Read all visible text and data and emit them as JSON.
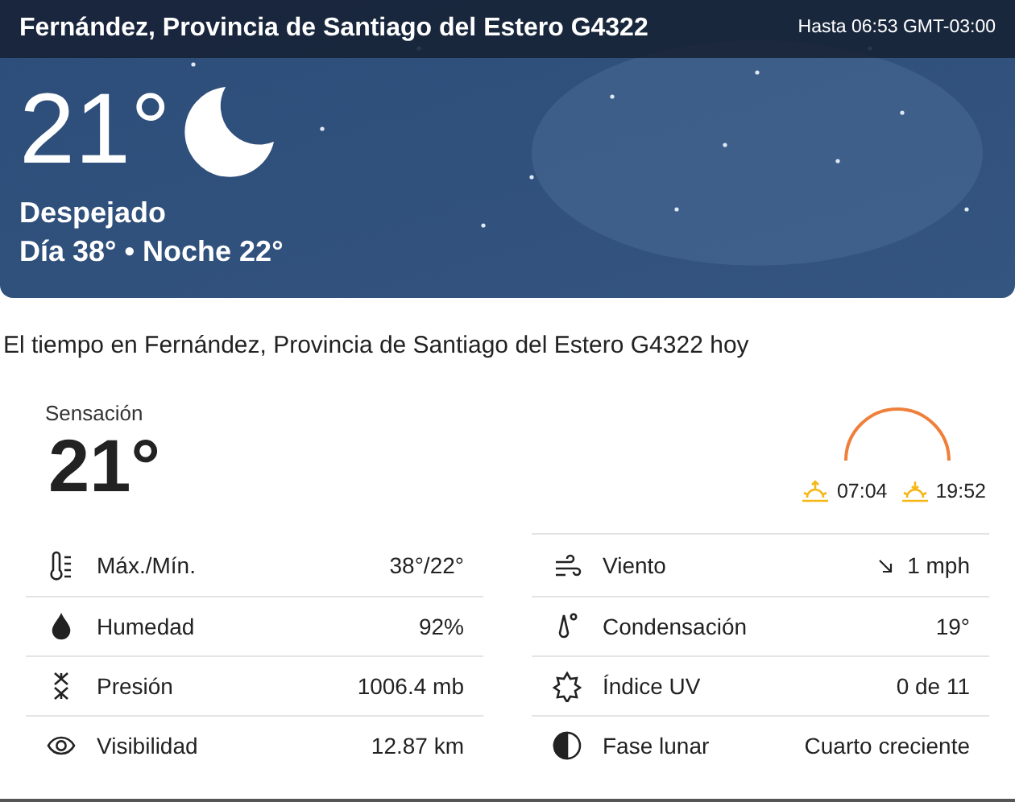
{
  "hero": {
    "location": "Fernández, Provincia de Santiago del Estero G4322",
    "valid_until": "Hasta 06:53 GMT-03:00",
    "temperature": "21°",
    "condition": "Despejado",
    "day_night": "Día 38° • Noche 22°"
  },
  "title": "El tiempo en Fernández, Provincia de Santiago del Estero G4322 hoy",
  "feels_like": {
    "label": "Sensación",
    "value": "21°"
  },
  "sun": {
    "sunrise": "07:04",
    "sunset": "19:52"
  },
  "details_left": [
    {
      "kind": "thermometer",
      "label": "Máx./Mín.",
      "value": "38°/22°"
    },
    {
      "kind": "drop",
      "label": "Humedad",
      "value": "92%"
    },
    {
      "kind": "pressure",
      "label": "Presión",
      "value": "1006.4 mb"
    },
    {
      "kind": "eye",
      "label": "Visibilidad",
      "value": "12.87 km"
    }
  ],
  "details_right": [
    {
      "kind": "wind",
      "label": "Viento",
      "value": "1 mph"
    },
    {
      "kind": "dewpoint",
      "label": "Condensación",
      "value": "19°"
    },
    {
      "kind": "uv",
      "label": "Índice UV",
      "value": "0 de 11"
    },
    {
      "kind": "moon",
      "label": "Fase lunar",
      "value": "Cuarto creciente"
    }
  ]
}
